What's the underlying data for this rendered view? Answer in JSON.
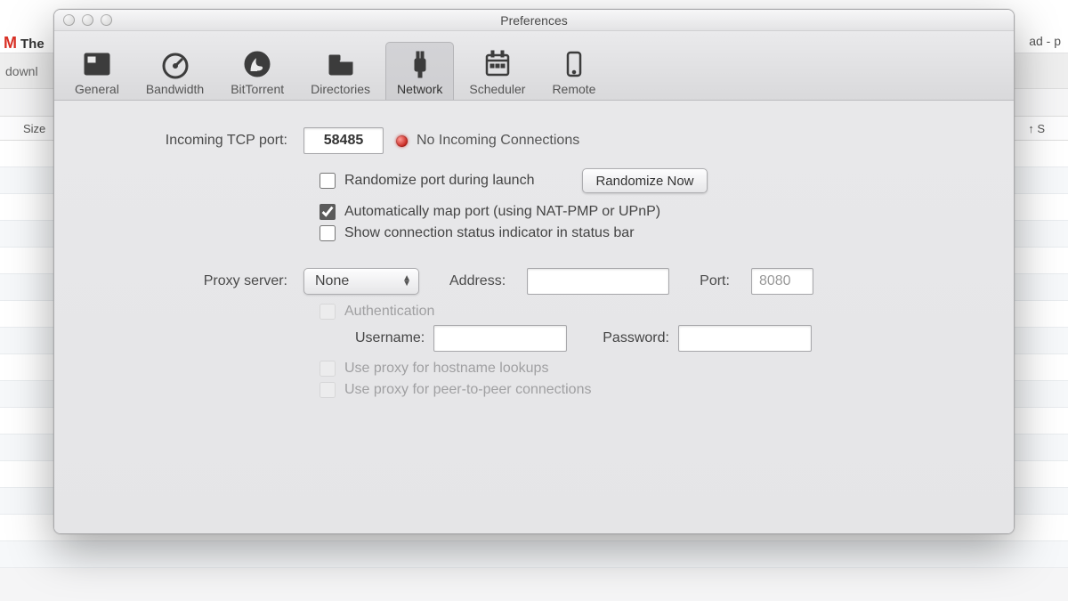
{
  "background": {
    "tab_left_fragment": "The",
    "tab_left_sub": "downl",
    "tab_right_fragment": "ad - p",
    "col_size": "Size",
    "col_s": "S"
  },
  "window": {
    "title": "Preferences"
  },
  "toolbar": {
    "items": [
      {
        "key": "general",
        "label": "General"
      },
      {
        "key": "bandwidth",
        "label": "Bandwidth"
      },
      {
        "key": "bittorrent",
        "label": "BitTorrent"
      },
      {
        "key": "directories",
        "label": "Directories"
      },
      {
        "key": "network",
        "label": "Network"
      },
      {
        "key": "scheduler",
        "label": "Scheduler"
      },
      {
        "key": "remote",
        "label": "Remote"
      }
    ],
    "selected_key": "network"
  },
  "network": {
    "incoming_port_label": "Incoming TCP port:",
    "incoming_port_value": "58485",
    "status_text": "No Incoming Connections",
    "status_color": "#c3211a",
    "checkboxes": {
      "randomize": {
        "label": "Randomize port during launch",
        "checked": false
      },
      "automap": {
        "label": "Automatically map port (using NAT-PMP or UPnP)",
        "checked": true
      },
      "showstatus": {
        "label": "Show connection status indicator in status bar",
        "checked": false
      }
    },
    "randomize_button": "Randomize Now",
    "proxy": {
      "label": "Proxy server:",
      "selected": "None",
      "address_label": "Address:",
      "address_value": "",
      "port_label": "Port:",
      "port_value": "8080",
      "auth": {
        "label": "Authentication",
        "checked": false,
        "enabled": false
      },
      "username_label": "Username:",
      "username_value": "",
      "password_label": "Password:",
      "password_value": "",
      "use_hostname": {
        "label": "Use proxy for hostname lookups",
        "checked": false,
        "enabled": false
      },
      "use_p2p": {
        "label": "Use proxy for peer-to-peer connections",
        "checked": false,
        "enabled": false
      }
    }
  }
}
